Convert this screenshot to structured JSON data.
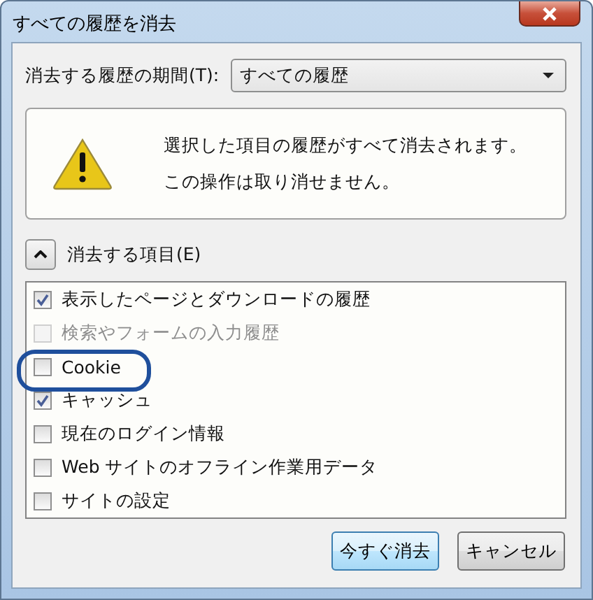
{
  "window": {
    "title": "すべての履歴を消去"
  },
  "time_range": {
    "label": "消去する履歴の期間(T):",
    "value": "すべての履歴"
  },
  "warning": {
    "lines": [
      "選択した項目の履歴がすべて消去されます。",
      "この操作は取り消せません。"
    ]
  },
  "details": {
    "label": "消去する項目(E)",
    "expanded": true
  },
  "items": [
    {
      "label": "表示したページとダウンロードの履歴",
      "checked": true,
      "disabled": false,
      "circled": false
    },
    {
      "label": "検索やフォームの入力履歴",
      "checked": false,
      "disabled": true,
      "circled": false
    },
    {
      "label": "Cookie",
      "checked": false,
      "disabled": false,
      "circled": true
    },
    {
      "label": "キャッシュ",
      "checked": true,
      "disabled": false,
      "circled": false
    },
    {
      "label": "現在のログイン情報",
      "checked": false,
      "disabled": false,
      "circled": false
    },
    {
      "label": "Web サイトのオフライン作業用データ",
      "checked": false,
      "disabled": false,
      "circled": false
    },
    {
      "label": "サイトの設定",
      "checked": false,
      "disabled": false,
      "circled": false
    }
  ],
  "buttons": [
    {
      "label": "今すぐ消去",
      "default": true
    },
    {
      "label": "キャンセル",
      "default": false
    }
  ]
}
